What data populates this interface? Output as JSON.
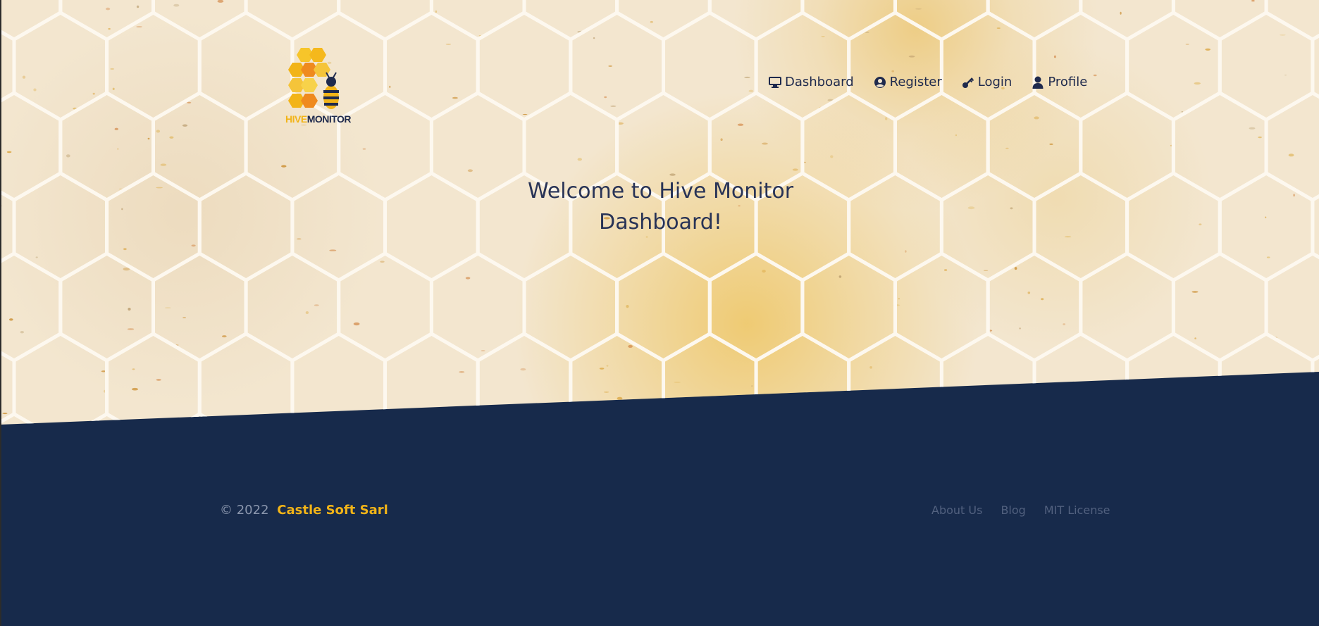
{
  "brand": {
    "logo_word_1": "HIVE",
    "logo_word_2": "MONITOR",
    "accent_color": "#f2b418",
    "navy_color": "#172a4b"
  },
  "nav": {
    "items": [
      {
        "label": "Dashboard",
        "icon": "monitor-icon"
      },
      {
        "label": "Register",
        "icon": "user-circle-icon"
      },
      {
        "label": "Login",
        "icon": "key-icon"
      },
      {
        "label": "Profile",
        "icon": "user-icon"
      }
    ]
  },
  "hero": {
    "title_line_1": "Welcome to Hive Monitor",
    "title_line_2": "Dashboard!"
  },
  "footer": {
    "copyright": "© 2022",
    "company": "Castle Soft Sarl",
    "links": [
      "About Us",
      "Blog",
      "MIT License"
    ]
  }
}
